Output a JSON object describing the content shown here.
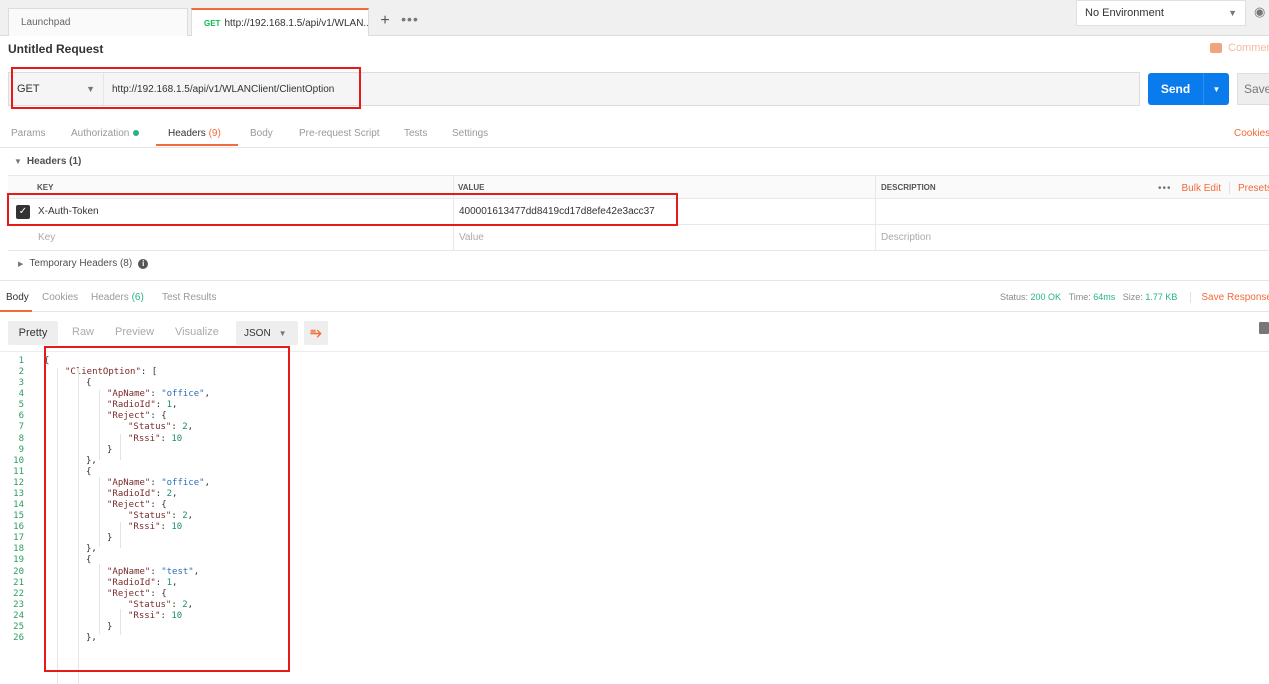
{
  "tabs": [
    {
      "label": "Launchpad"
    },
    {
      "method": "GET",
      "label": "http://192.168.1.5/api/v1/WLAN..."
    }
  ],
  "tab_add": "+",
  "tab_more": "•••",
  "environment": {
    "label": "No Environment"
  },
  "request": {
    "title": "Untitled Request",
    "comments_label": "Comments",
    "method": "GET",
    "url": "http://192.168.1.5/api/v1/WLANClient/ClientOption",
    "send_label": "Send",
    "save_label": "Save"
  },
  "request_tabs": [
    {
      "label": "Params"
    },
    {
      "label": "Authorization"
    },
    {
      "label": "Headers",
      "count": "(9)"
    },
    {
      "label": "Body"
    },
    {
      "label": "Pre-request Script"
    },
    {
      "label": "Tests"
    },
    {
      "label": "Settings"
    }
  ],
  "cookies_label": "Cookies",
  "headers": {
    "section_label": "Headers (1)",
    "col_key": "KEY",
    "col_value": "VALUE",
    "col_description": "DESCRIPTION",
    "bulk_edit": "Bulk Edit",
    "presets": "Presets",
    "rows": [
      {
        "key": "X-Auth-Token",
        "value": "400001613477dd8419cd17d8efe42e3acc37",
        "description": ""
      }
    ],
    "placeholder": {
      "key": "Key",
      "value": "Value",
      "description": "Description"
    },
    "temporary_label": "Temporary Headers (8)"
  },
  "response": {
    "tabs": [
      {
        "label": "Body"
      },
      {
        "label": "Cookies"
      },
      {
        "label": "Headers",
        "count": "(6)"
      },
      {
        "label": "Test Results"
      }
    ],
    "status_label": "Status:",
    "status": "200 OK",
    "time_label": "Time:",
    "time": "64ms",
    "size_label": "Size:",
    "size": "1.77 KB",
    "save_response": "Save Response",
    "formats": [
      "Pretty",
      "Raw",
      "Preview",
      "Visualize"
    ],
    "format_type": "JSON"
  },
  "code_lines": [
    {
      "n": "1",
      "i": 0,
      "t": [
        [
          "punc",
          "{"
        ]
      ]
    },
    {
      "n": "2",
      "i": 1,
      "t": [
        [
          "key",
          "\"ClientOption\""
        ],
        [
          "punc",
          ": ["
        ]
      ]
    },
    {
      "n": "3",
      "i": 2,
      "t": [
        [
          "punc",
          "{"
        ]
      ]
    },
    {
      "n": "4",
      "i": 3,
      "t": [
        [
          "key",
          "\"ApName\""
        ],
        [
          "punc",
          ": "
        ],
        [
          "str",
          "\"office\""
        ],
        [
          "punc",
          ","
        ]
      ]
    },
    {
      "n": "5",
      "i": 3,
      "t": [
        [
          "key",
          "\"RadioId\""
        ],
        [
          "punc",
          ": "
        ],
        [
          "num",
          "1"
        ],
        [
          "punc",
          ","
        ]
      ]
    },
    {
      "n": "6",
      "i": 3,
      "t": [
        [
          "key",
          "\"Reject\""
        ],
        [
          "punc",
          ": {"
        ]
      ]
    },
    {
      "n": "7",
      "i": 4,
      "t": [
        [
          "key",
          "\"Status\""
        ],
        [
          "punc",
          ": "
        ],
        [
          "num",
          "2"
        ],
        [
          "punc",
          ","
        ]
      ]
    },
    {
      "n": "8",
      "i": 4,
      "t": [
        [
          "key",
          "\"Rssi\""
        ],
        [
          "punc",
          ": "
        ],
        [
          "num",
          "10"
        ]
      ]
    },
    {
      "n": "9",
      "i": 3,
      "t": [
        [
          "punc",
          "}"
        ]
      ]
    },
    {
      "n": "10",
      "i": 2,
      "t": [
        [
          "punc",
          "},"
        ]
      ]
    },
    {
      "n": "11",
      "i": 2,
      "t": [
        [
          "punc",
          "{"
        ]
      ]
    },
    {
      "n": "12",
      "i": 3,
      "t": [
        [
          "key",
          "\"ApName\""
        ],
        [
          "punc",
          ": "
        ],
        [
          "str",
          "\"office\""
        ],
        [
          "punc",
          ","
        ]
      ]
    },
    {
      "n": "13",
      "i": 3,
      "t": [
        [
          "key",
          "\"RadioId\""
        ],
        [
          "punc",
          ": "
        ],
        [
          "num",
          "2"
        ],
        [
          "punc",
          ","
        ]
      ]
    },
    {
      "n": "14",
      "i": 3,
      "t": [
        [
          "key",
          "\"Reject\""
        ],
        [
          "punc",
          ": {"
        ]
      ]
    },
    {
      "n": "15",
      "i": 4,
      "t": [
        [
          "key",
          "\"Status\""
        ],
        [
          "punc",
          ": "
        ],
        [
          "num",
          "2"
        ],
        [
          "punc",
          ","
        ]
      ]
    },
    {
      "n": "16",
      "i": 4,
      "t": [
        [
          "key",
          "\"Rssi\""
        ],
        [
          "punc",
          ": "
        ],
        [
          "num",
          "10"
        ]
      ]
    },
    {
      "n": "17",
      "i": 3,
      "t": [
        [
          "punc",
          "}"
        ]
      ]
    },
    {
      "n": "18",
      "i": 2,
      "t": [
        [
          "punc",
          "},"
        ]
      ]
    },
    {
      "n": "19",
      "i": 2,
      "t": [
        [
          "punc",
          "{"
        ]
      ]
    },
    {
      "n": "20",
      "i": 3,
      "t": [
        [
          "key",
          "\"ApName\""
        ],
        [
          "punc",
          ": "
        ],
        [
          "str",
          "\"test\""
        ],
        [
          "punc",
          ","
        ]
      ]
    },
    {
      "n": "21",
      "i": 3,
      "t": [
        [
          "key",
          "\"RadioId\""
        ],
        [
          "punc",
          ": "
        ],
        [
          "num",
          "1"
        ],
        [
          "punc",
          ","
        ]
      ]
    },
    {
      "n": "22",
      "i": 3,
      "t": [
        [
          "key",
          "\"Reject\""
        ],
        [
          "punc",
          ": {"
        ]
      ]
    },
    {
      "n": "23",
      "i": 4,
      "t": [
        [
          "key",
          "\"Status\""
        ],
        [
          "punc",
          ": "
        ],
        [
          "num",
          "2"
        ],
        [
          "punc",
          ","
        ]
      ]
    },
    {
      "n": "24",
      "i": 4,
      "t": [
        [
          "key",
          "\"Rssi\""
        ],
        [
          "punc",
          ": "
        ],
        [
          "num",
          "10"
        ]
      ]
    },
    {
      "n": "25",
      "i": 3,
      "t": [
        [
          "punc",
          "}"
        ]
      ]
    },
    {
      "n": "26",
      "i": 2,
      "t": [
        [
          "punc",
          "},"
        ]
      ]
    }
  ],
  "colors": {
    "accent": "#f26b3a",
    "send": "#097bed",
    "success": "#26b47f",
    "annotation": "#e31b1b"
  }
}
